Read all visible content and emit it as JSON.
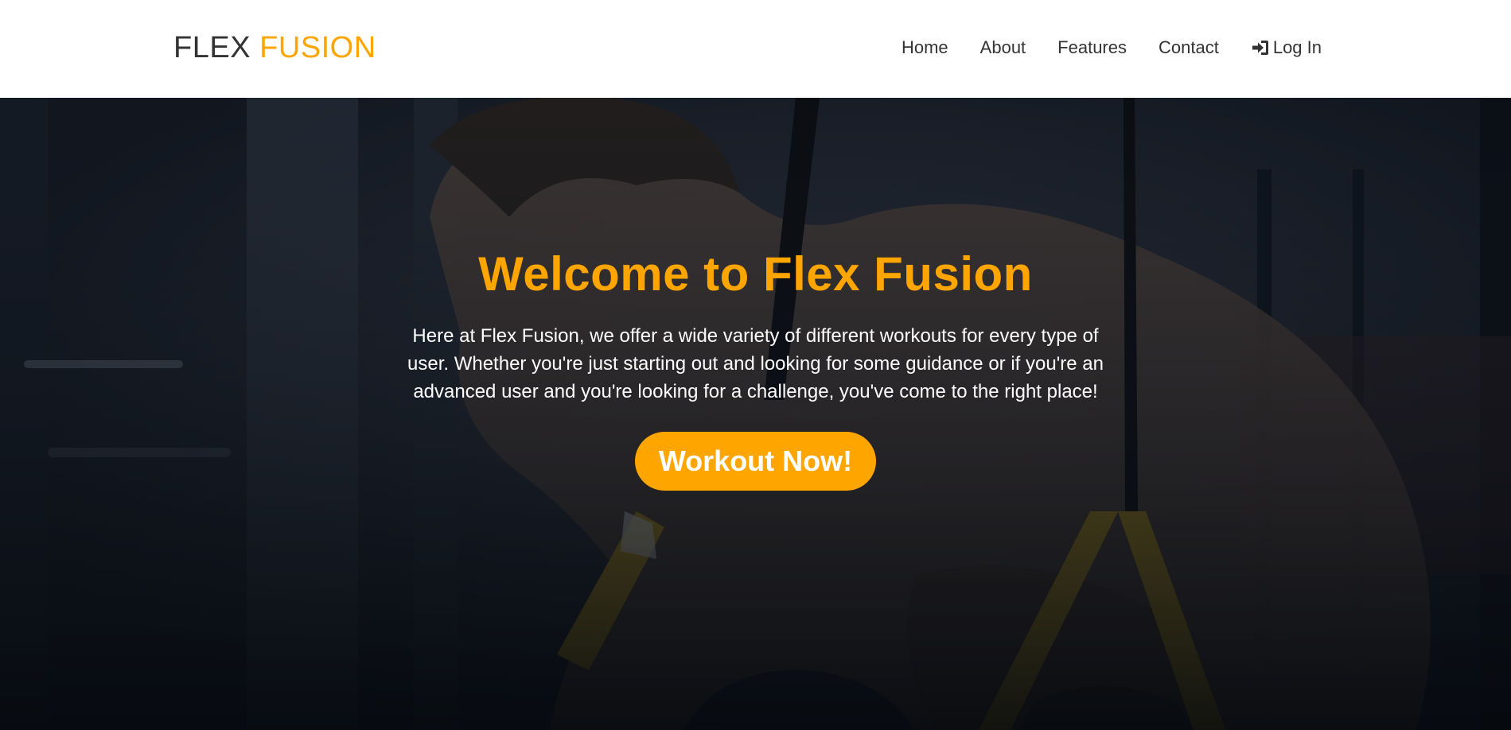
{
  "brand": {
    "part1": "FLEX",
    "part2": "FUSION"
  },
  "nav": {
    "home": "Home",
    "about": "About",
    "features": "Features",
    "contact": "Contact",
    "login": "Log In",
    "login_icon": "sign-in-icon"
  },
  "hero": {
    "title": "Welcome to Flex Fusion",
    "text": "Here at Flex Fusion, we offer a wide variety of different workouts for every type of user. Whether you're just starting out and looking for some guidance or if you're an advanced user and you're looking for a challenge, you've come to the right place!",
    "button": "Workout Now!"
  },
  "colors": {
    "accent": "#ffa500",
    "text_dark": "#333333",
    "overlay": "#0b1018"
  }
}
